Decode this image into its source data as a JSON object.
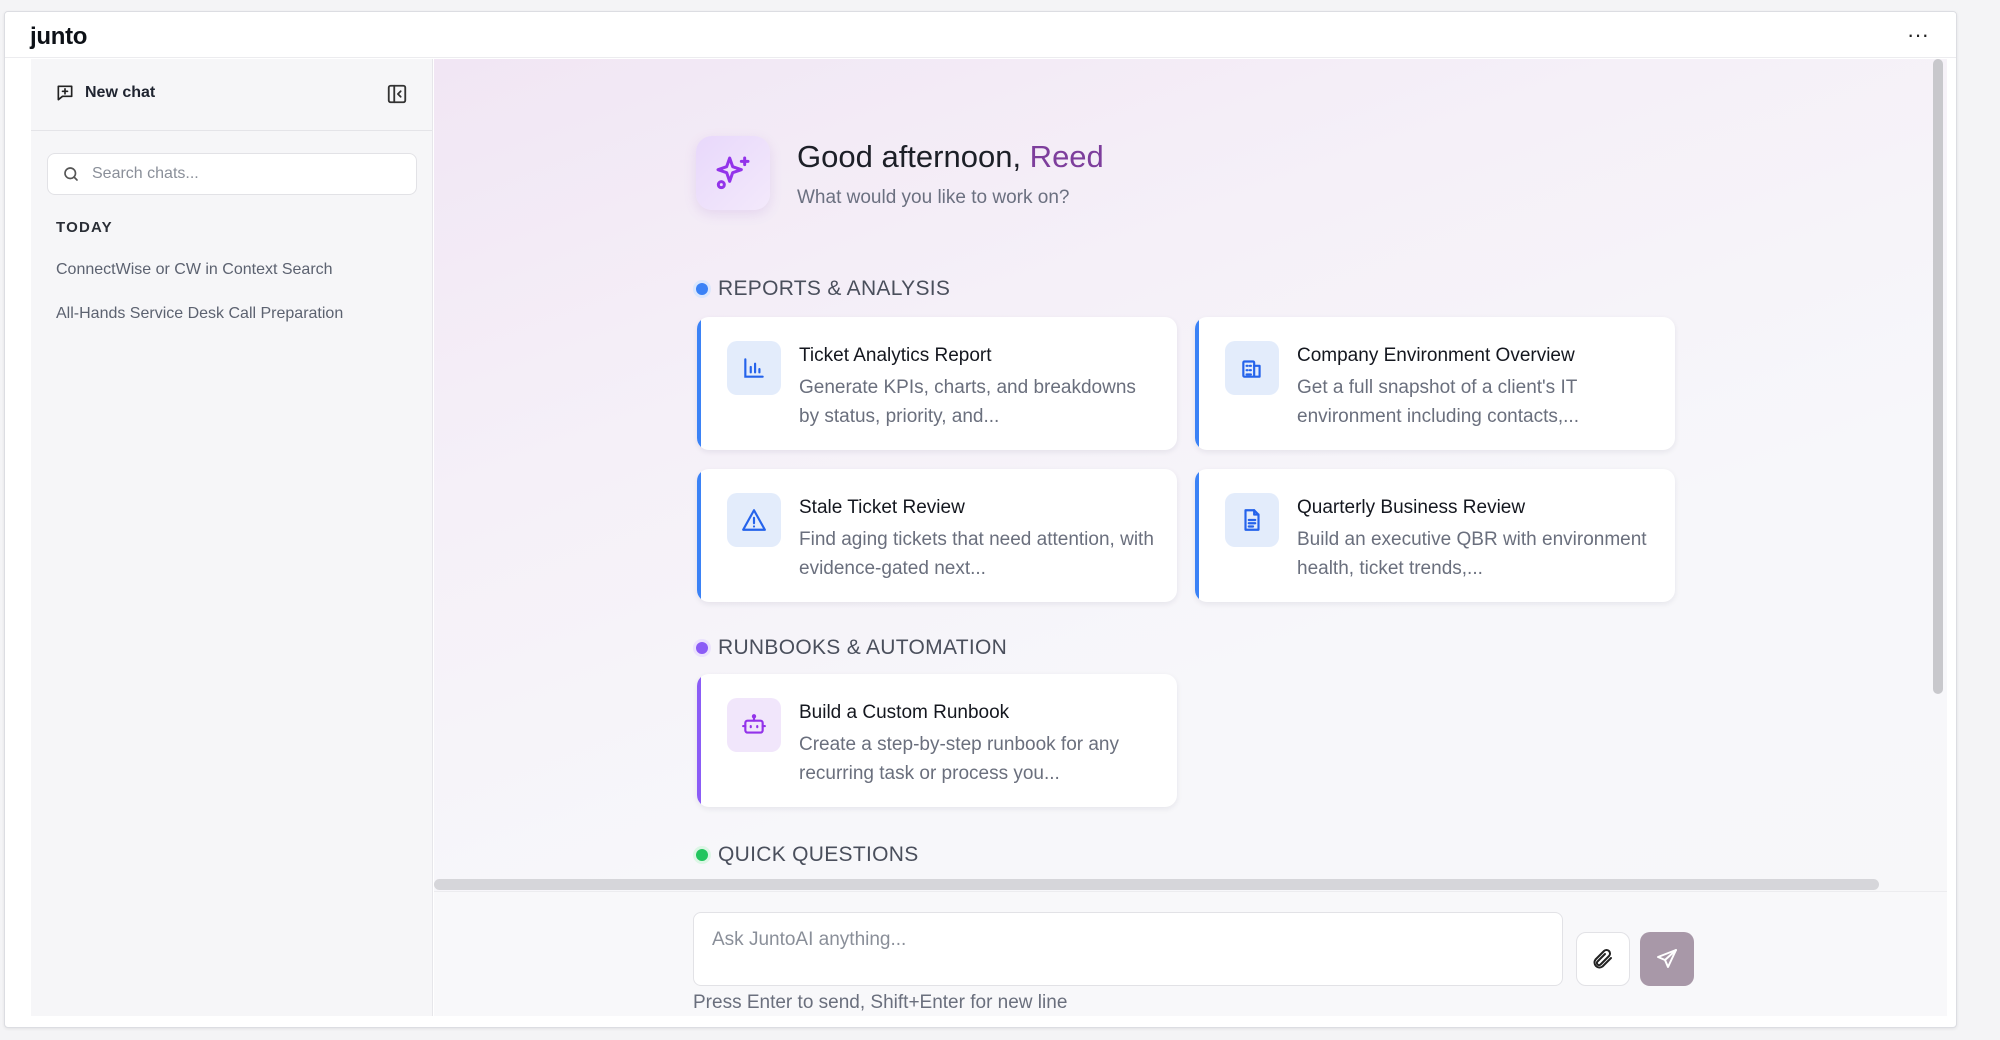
{
  "app": {
    "title": "junto",
    "more_label": "···"
  },
  "sidebar": {
    "new_chat_label": "New chat",
    "search_placeholder": "Search chats...",
    "section": "TODAY",
    "chats": [
      {
        "label": "ConnectWise or CW in Context Search"
      },
      {
        "label": "All-Hands Service Desk Call Preparation"
      }
    ]
  },
  "hero": {
    "greeting": "Good afternoon,",
    "name": " Reed",
    "subtitle": "What would you like to work on?"
  },
  "sections": {
    "reports": {
      "label": "REPORTS & ANALYSIS",
      "color": "#3b82f6",
      "cards": [
        {
          "title": "Ticket Analytics Report",
          "desc": "Generate KPIs, charts, and breakdowns by status, priority, and...",
          "icon": "bar-chart-icon"
        },
        {
          "title": "Company Environment Overview",
          "desc": "Get a full snapshot of a client's IT environment including contacts,...",
          "icon": "building-icon"
        },
        {
          "title": "Stale Ticket Review",
          "desc": "Find aging tickets that need attention, with evidence-gated next...",
          "icon": "warning-icon"
        },
        {
          "title": "Quarterly Business Review",
          "desc": "Build an executive QBR with environment health, ticket trends,...",
          "icon": "document-icon"
        }
      ]
    },
    "runbooks": {
      "label": "RUNBOOKS & AUTOMATION",
      "color": "#8b5cf6",
      "cards": [
        {
          "title": "Build a Custom Runbook",
          "desc": "Create a step-by-step runbook for any recurring task or process you...",
          "icon": "robot-icon"
        }
      ]
    },
    "quick": {
      "label": "QUICK QUESTIONS",
      "color": "#22c55e"
    }
  },
  "composer": {
    "placeholder": "Ask JuntoAI anything...",
    "hint": "Press Enter to send, Shift+Enter for new line"
  }
}
